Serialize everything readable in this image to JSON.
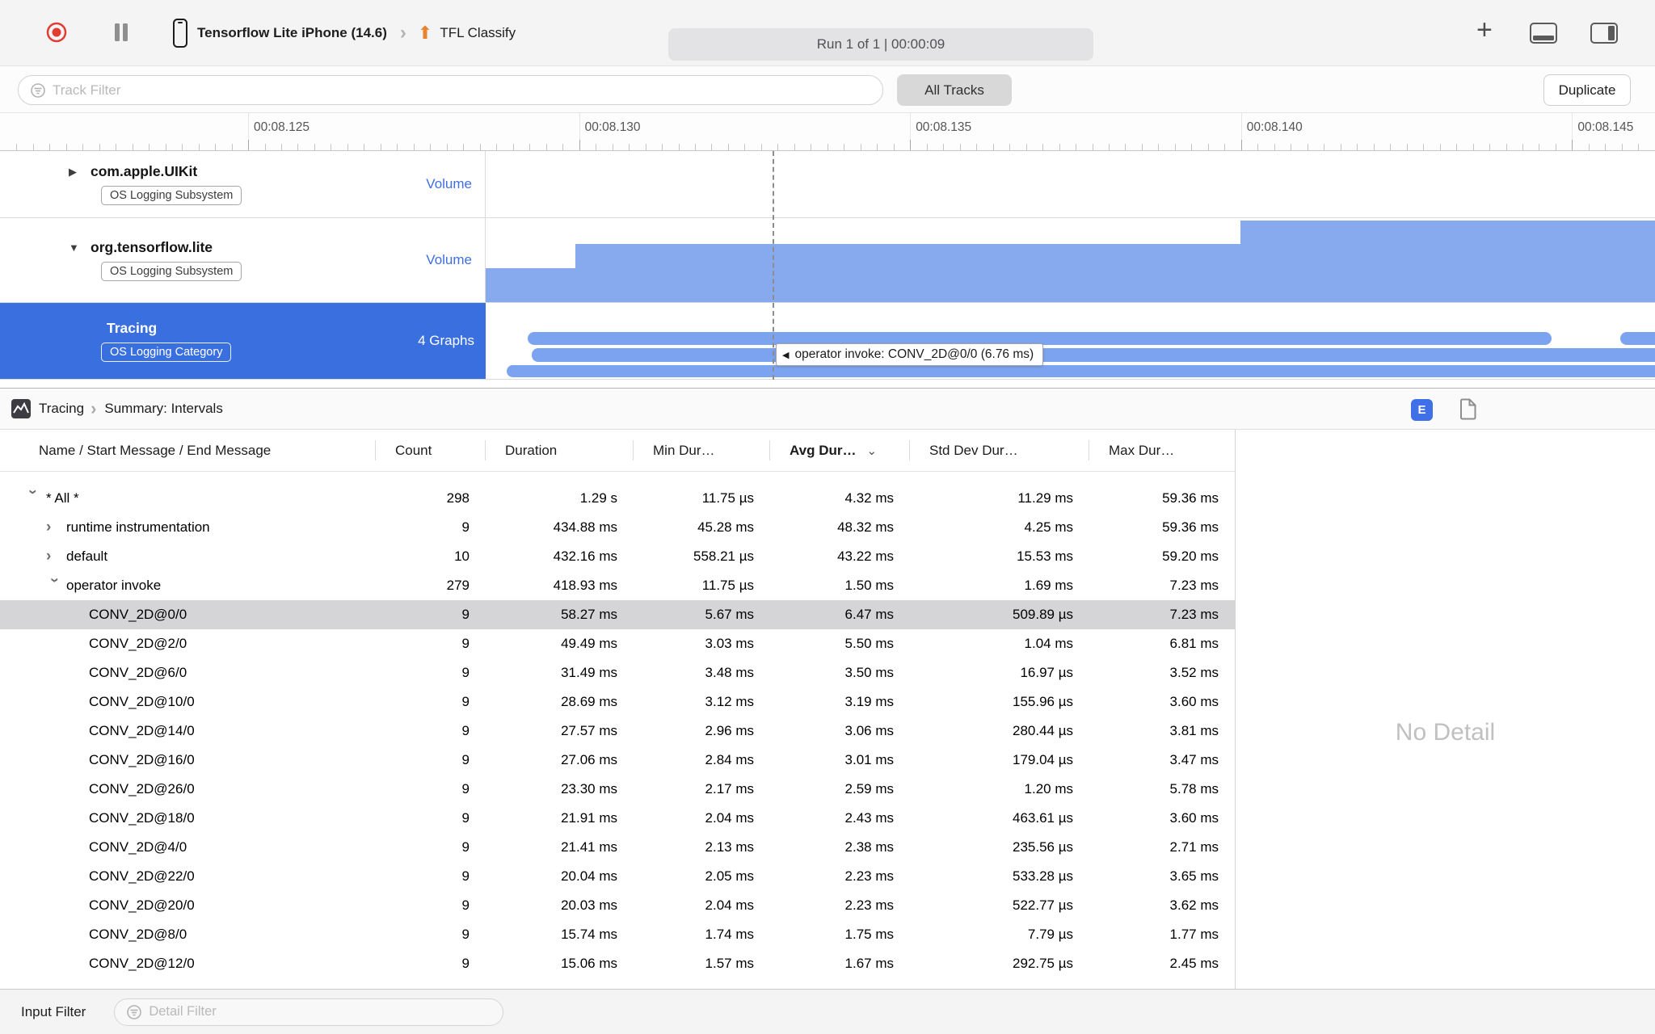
{
  "toolbar": {
    "device_name": "Tensorflow Lite iPhone (14.6)",
    "target_name": "TFL Classify",
    "run_status": "Run 1 of 1  |  00:00:09"
  },
  "filter_bar": {
    "track_filter_placeholder": "Track Filter",
    "all_tracks_label": "All Tracks",
    "duplicate_label": "Duplicate"
  },
  "timeline": {
    "ruler_labels": [
      "00:08.125",
      "00:08.130",
      "00:08.135",
      "00:08.140",
      "00:08.145"
    ],
    "tooltip": "operator invoke: CONV_2D@0/0 (6.76 ms)",
    "tracks": [
      {
        "name": "com.apple.UIKit",
        "badge": "OS Logging Subsystem",
        "meta": "Volume"
      },
      {
        "name": "org.tensorflow.lite",
        "badge": "OS Logging Subsystem",
        "meta": "Volume"
      },
      {
        "name": "Tracing",
        "badge": "OS Logging Category",
        "meta": "4 Graphs"
      }
    ]
  },
  "detail_pane": {
    "breadcrumb_root": "Tracing",
    "breadcrumb_page": "Summary: Intervals",
    "extended_detail_label": "E",
    "no_detail_text": "No Detail",
    "table": {
      "columns": [
        {
          "label": "Name / Start Message / End Message",
          "sorted": false
        },
        {
          "label": "Count",
          "sorted": false
        },
        {
          "label": "Duration",
          "sorted": false
        },
        {
          "label": "Min Dur…",
          "sorted": false
        },
        {
          "label": "Avg Dur…",
          "sorted": true
        },
        {
          "label": "Std Dev Dur…",
          "sorted": false
        },
        {
          "label": "Max Dur…",
          "sorted": false
        }
      ],
      "rows": [
        {
          "name": "* All *",
          "level": 0,
          "disclosure": "expanded",
          "selected": false,
          "values": [
            "298",
            "1.29 s",
            "11.75 µs",
            "4.32 ms",
            "11.29 ms",
            "59.36 ms"
          ]
        },
        {
          "name": "runtime instrumentation",
          "level": 1,
          "disclosure": "collapsed",
          "selected": false,
          "values": [
            "9",
            "434.88 ms",
            "45.28 ms",
            "48.32 ms",
            "4.25 ms",
            "59.36 ms"
          ]
        },
        {
          "name": "default",
          "level": 1,
          "disclosure": "collapsed",
          "selected": false,
          "values": [
            "10",
            "432.16 ms",
            "558.21 µs",
            "43.22 ms",
            "15.53 ms",
            "59.20 ms"
          ]
        },
        {
          "name": "operator invoke",
          "level": 1,
          "disclosure": "expanded",
          "selected": false,
          "values": [
            "279",
            "418.93 ms",
            "11.75 µs",
            "1.50 ms",
            "1.69 ms",
            "7.23 ms"
          ]
        },
        {
          "name": "CONV_2D@0/0",
          "level": 2,
          "disclosure": null,
          "selected": true,
          "values": [
            "9",
            "58.27 ms",
            "5.67 ms",
            "6.47 ms",
            "509.89 µs",
            "7.23 ms"
          ]
        },
        {
          "name": "CONV_2D@2/0",
          "level": 2,
          "disclosure": null,
          "selected": false,
          "values": [
            "9",
            "49.49 ms",
            "3.03 ms",
            "5.50 ms",
            "1.04 ms",
            "6.81 ms"
          ]
        },
        {
          "name": "CONV_2D@6/0",
          "level": 2,
          "disclosure": null,
          "selected": false,
          "values": [
            "9",
            "31.49 ms",
            "3.48 ms",
            "3.50 ms",
            "16.97 µs",
            "3.52 ms"
          ]
        },
        {
          "name": "CONV_2D@10/0",
          "level": 2,
          "disclosure": null,
          "selected": false,
          "values": [
            "9",
            "28.69 ms",
            "3.12 ms",
            "3.19 ms",
            "155.96 µs",
            "3.60 ms"
          ]
        },
        {
          "name": "CONV_2D@14/0",
          "level": 2,
          "disclosure": null,
          "selected": false,
          "values": [
            "9",
            "27.57 ms",
            "2.96 ms",
            "3.06 ms",
            "280.44 µs",
            "3.81 ms"
          ]
        },
        {
          "name": "CONV_2D@16/0",
          "level": 2,
          "disclosure": null,
          "selected": false,
          "values": [
            "9",
            "27.06 ms",
            "2.84 ms",
            "3.01 ms",
            "179.04 µs",
            "3.47 ms"
          ]
        },
        {
          "name": "CONV_2D@26/0",
          "level": 2,
          "disclosure": null,
          "selected": false,
          "values": [
            "9",
            "23.30 ms",
            "2.17 ms",
            "2.59 ms",
            "1.20 ms",
            "5.78 ms"
          ]
        },
        {
          "name": "CONV_2D@18/0",
          "level": 2,
          "disclosure": null,
          "selected": false,
          "values": [
            "9",
            "21.91 ms",
            "2.04 ms",
            "2.43 ms",
            "463.61 µs",
            "3.60 ms"
          ]
        },
        {
          "name": "CONV_2D@4/0",
          "level": 2,
          "disclosure": null,
          "selected": false,
          "values": [
            "9",
            "21.41 ms",
            "2.13 ms",
            "2.38 ms",
            "235.56 µs",
            "2.71 ms"
          ]
        },
        {
          "name": "CONV_2D@22/0",
          "level": 2,
          "disclosure": null,
          "selected": false,
          "values": [
            "9",
            "20.04 ms",
            "2.05 ms",
            "2.23 ms",
            "533.28 µs",
            "3.65 ms"
          ]
        },
        {
          "name": "CONV_2D@20/0",
          "level": 2,
          "disclosure": null,
          "selected": false,
          "values": [
            "9",
            "20.03 ms",
            "2.04 ms",
            "2.23 ms",
            "522.77 µs",
            "3.62 ms"
          ]
        },
        {
          "name": "CONV_2D@8/0",
          "level": 2,
          "disclosure": null,
          "selected": false,
          "values": [
            "9",
            "15.74 ms",
            "1.74 ms",
            "1.75 ms",
            "7.79 µs",
            "1.77 ms"
          ]
        },
        {
          "name": "CONV_2D@12/0",
          "level": 2,
          "disclosure": null,
          "selected": false,
          "values": [
            "9",
            "15.06 ms",
            "1.57 ms",
            "1.67 ms",
            "292.75 µs",
            "2.45 ms"
          ]
        }
      ]
    }
  },
  "bottom_bar": {
    "input_filter_label": "Input Filter",
    "detail_filter_placeholder": "Detail Filter"
  }
}
